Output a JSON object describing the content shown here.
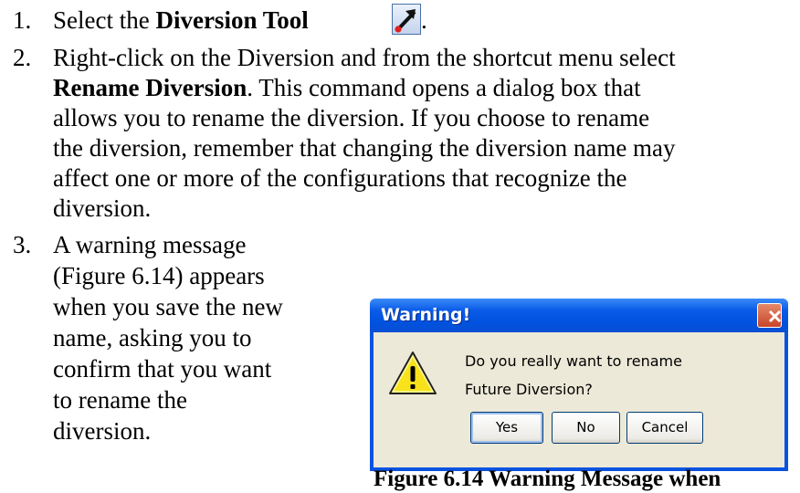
{
  "steps": [
    {
      "number": "1.",
      "lines": [
        {
          "prefix": "Select the ",
          "bold": "Diversion Tool",
          "suffix": "."
        }
      ]
    },
    {
      "number": "2.",
      "lines": [
        "Right-click on the Diversion and from the shortcut menu select",
        {
          "bold": "Rename Diversion",
          "suffix": ".  This command opens a dialog box that"
        },
        "allows you to rename the diversion.  If you choose to rename",
        "the diversion, remember that changing the diversion name may",
        "affect one or more of the configurations that recognize the",
        "diversion."
      ]
    },
    {
      "number": "3.",
      "lines": [
        "A warning message",
        "(Figure 6.14) appears",
        "when you save the new",
        "name, asking you to",
        "confirm that you want",
        "to rename the",
        "diversion."
      ]
    }
  ],
  "tool_icon": "diversion-arrow-icon",
  "dialog": {
    "title": "Warning!",
    "message_lines": [
      "Do you really want to rename",
      "Future Diversion?"
    ],
    "buttons": {
      "yes": "Yes",
      "no": "No",
      "cancel": "Cancel"
    },
    "title_color": "#0a53e0",
    "client_color": "#ece9d8"
  },
  "caption": "Figure 6.14  Warning Message when"
}
